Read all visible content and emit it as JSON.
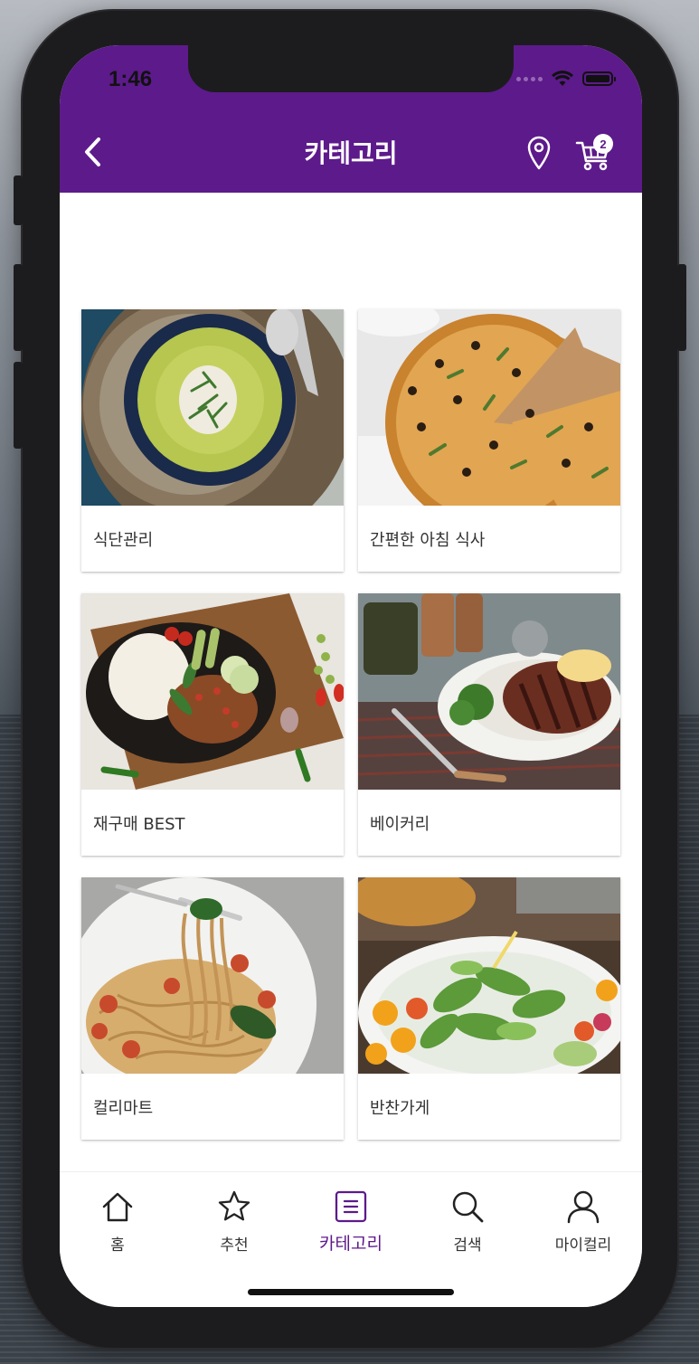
{
  "status_bar": {
    "time": "1:46"
  },
  "header": {
    "title": "카테고리",
    "cart_count": "2",
    "accent": "#5d1a8b"
  },
  "categories": [
    {
      "label": "식단관리",
      "image": "green-soup-bowl"
    },
    {
      "label": "간편한 아침 식사",
      "image": "pizza"
    },
    {
      "label": "재구매 BEST",
      "image": "rice-stir-fry-plate"
    },
    {
      "label": "베이커리",
      "image": "grilled-steak-plate"
    },
    {
      "label": "컬리마트",
      "image": "spaghetti"
    },
    {
      "label": "반찬가게",
      "image": "salad-bowl"
    }
  ],
  "tabbar": {
    "items": [
      {
        "label": "홈",
        "icon": "home-icon"
      },
      {
        "label": "추천",
        "icon": "star-icon"
      },
      {
        "label": "카테고리",
        "icon": "list-icon",
        "active": true
      },
      {
        "label": "검색",
        "icon": "search-icon"
      },
      {
        "label": "마이컬리",
        "icon": "user-icon"
      }
    ]
  }
}
